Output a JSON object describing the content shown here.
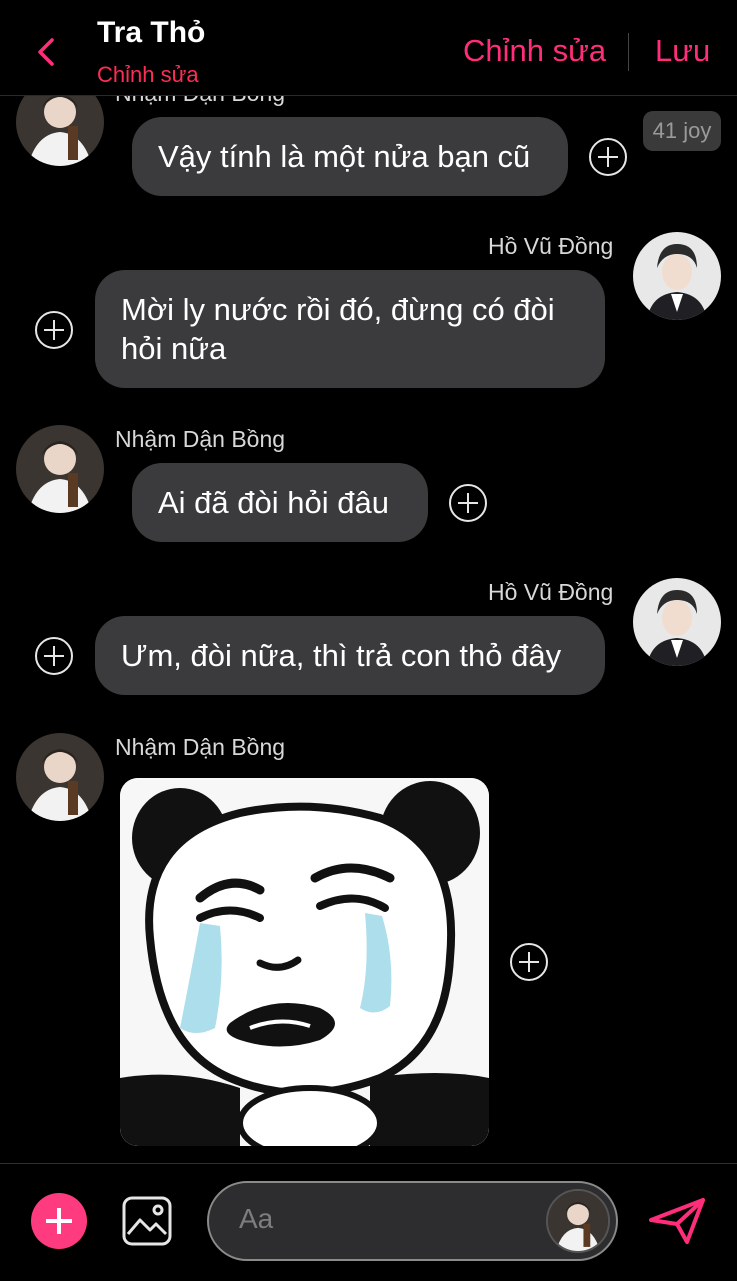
{
  "header": {
    "title": "Tra Thỏ",
    "subtitle": "Chỉnh sửa",
    "edit_label": "Chỉnh sửa",
    "save_label": "Lưu"
  },
  "messages": [
    {
      "sender": "Nhậm Dận Bồng",
      "side": "left",
      "text": "Vậy tính là một nửa bạn cũ",
      "badge": "41 joy"
    },
    {
      "sender": "Hồ Vũ Đồng",
      "side": "right",
      "text": "Mời ly nước rồi đó, đừng có đòi hỏi nữa"
    },
    {
      "sender": "Nhậm Dận Bồng",
      "side": "left",
      "text": "Ai đã đòi hỏi đâu"
    },
    {
      "sender": "Hồ Vũ Đồng",
      "side": "right",
      "text": "Ưm, đòi nữa, thì trả con thỏ đây"
    },
    {
      "sender": "Nhậm Dận Bồng",
      "side": "left",
      "type": "sticker",
      "sticker": "crying-panda-meme"
    }
  ],
  "composer": {
    "placeholder": "Aa"
  },
  "colors": {
    "accent": "#ff2d7a",
    "bubble": "#3b3b3d",
    "background": "#000000"
  },
  "icons": [
    "back-chevron-icon",
    "plus-circle-icon",
    "image-icon",
    "send-icon"
  ]
}
